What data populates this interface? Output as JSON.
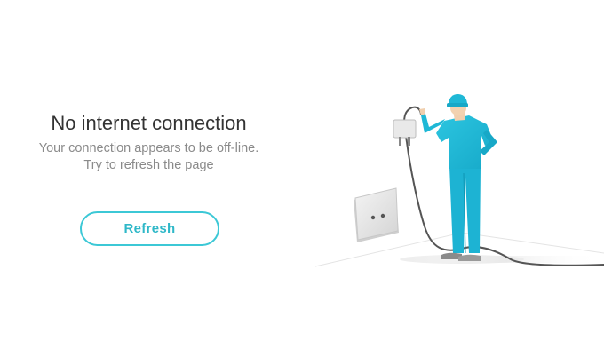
{
  "error": {
    "title": "No internet connection",
    "message_line1": "Your connection appears to be off-line.",
    "message_line2": "Try to refresh the page"
  },
  "actions": {
    "refresh_label": "Refresh"
  },
  "colors": {
    "accent": "#3cc8d6",
    "uniform": "#1fb8d6",
    "text_primary": "#333333",
    "text_secondary": "#8a8a8a"
  },
  "illustration": {
    "icon": "unplugged-worker-illustration"
  }
}
